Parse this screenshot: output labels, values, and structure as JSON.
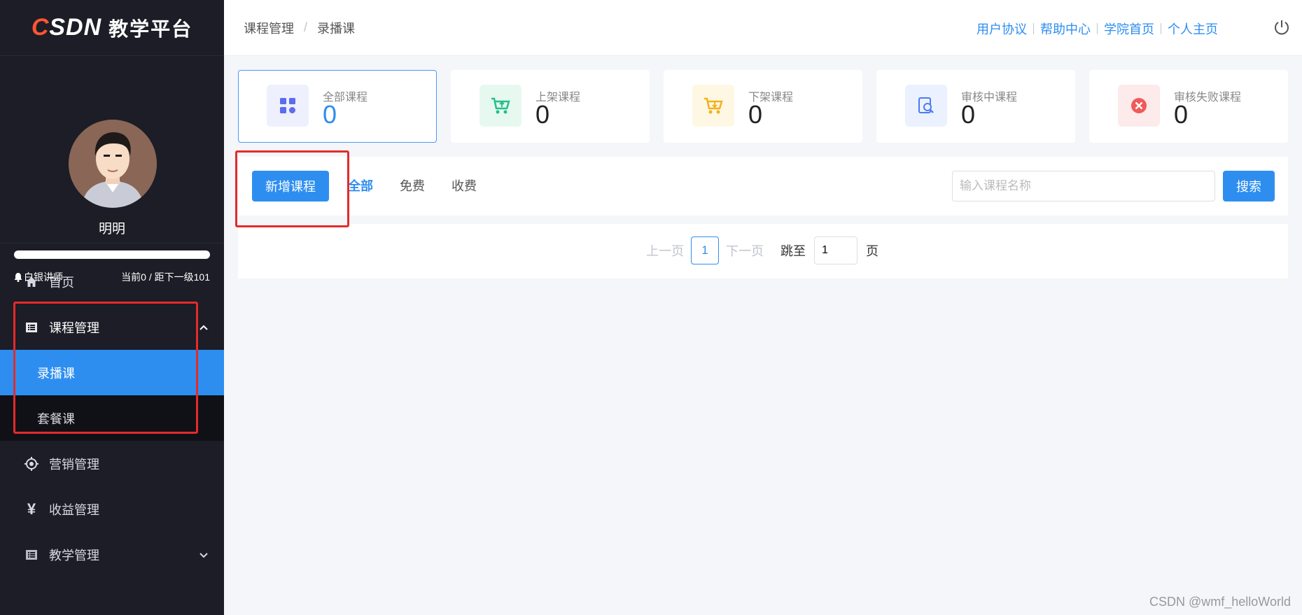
{
  "logo": {
    "brand": "CSDN",
    "title": "教学平台"
  },
  "profile": {
    "username": "明明",
    "level_name": "白银讲师",
    "level_progress_text": "当前0 / 距下一级101",
    "level_progress": 0
  },
  "sidebar": {
    "items": [
      {
        "label": "首页",
        "icon": "home-icon"
      },
      {
        "label": "课程管理",
        "icon": "list-icon",
        "expanded": true,
        "children": [
          {
            "label": "录播课",
            "active": true
          },
          {
            "label": "套餐课"
          }
        ]
      },
      {
        "label": "营销管理",
        "icon": "target-icon"
      },
      {
        "label": "收益管理",
        "icon": "yen-icon"
      },
      {
        "label": "教学管理",
        "icon": "list-icon",
        "expanded": false
      }
    ]
  },
  "header": {
    "breadcrumb": [
      "课程管理",
      "录播课"
    ],
    "separator": "/",
    "links": [
      "用户协议",
      "帮助中心",
      "学院首页",
      "个人主页"
    ]
  },
  "stats": [
    {
      "label": "全部课程",
      "value": "0",
      "icon": "grid-icon",
      "active": true,
      "color": "#5b6cf0",
      "bg": "#eef0fd"
    },
    {
      "label": "上架课程",
      "value": "0",
      "icon": "cart-up-icon",
      "color": "#23c08a",
      "bg": "#e7f8f1"
    },
    {
      "label": "下架课程",
      "value": "0",
      "icon": "cart-down-icon",
      "color": "#f3b21c",
      "bg": "#fef7e3"
    },
    {
      "label": "审核中课程",
      "value": "0",
      "icon": "search-doc-icon",
      "color": "#4a7cf5",
      "bg": "#ebf1fe"
    },
    {
      "label": "审核失败课程",
      "value": "0",
      "icon": "fail-icon",
      "color": "#f05a5a",
      "bg": "#fdeaea"
    }
  ],
  "toolbar": {
    "add_label": "新增课程",
    "tabs": [
      "全部",
      "免费",
      "收费"
    ],
    "active_tab": "全部",
    "search_placeholder": "输入课程名称",
    "search_value": "",
    "search_label": "搜索"
  },
  "pagination": {
    "prev": "上一页",
    "current": "1",
    "next": "下一页",
    "jump_label": "跳至",
    "jump_value": "1",
    "page_suffix": "页"
  },
  "watermark": "CSDN @wmf_helloWorld",
  "colors": {
    "accent": "#2e8ef0",
    "sidebar_bg": "#1c1d26",
    "annotation": "#e42a2a"
  }
}
